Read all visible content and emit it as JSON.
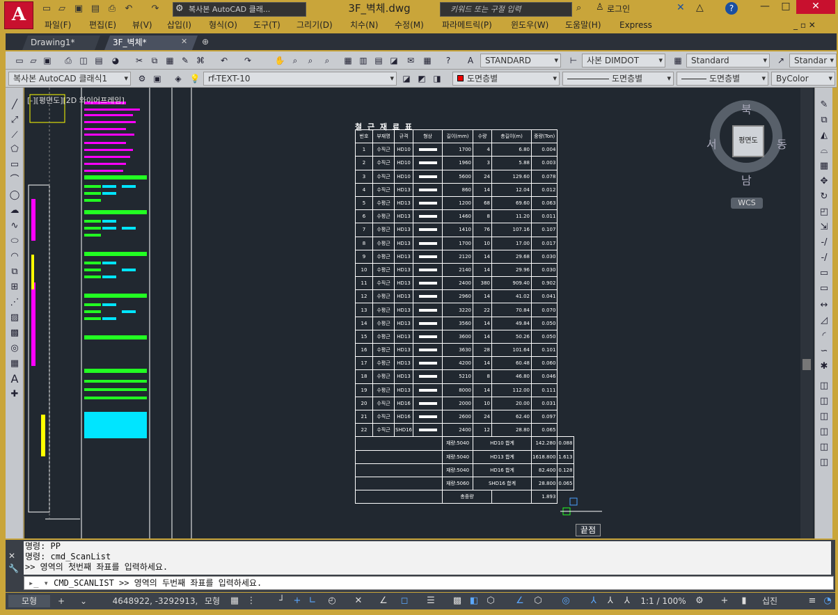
{
  "app": {
    "logo": "A",
    "workspace": "복사본 AutoCAD 클래...",
    "title": "3F_벽체.dwg",
    "search_placeholder": "키워드 또는 구절 입력",
    "login": "로그인"
  },
  "menu": [
    "파일(F)",
    "편집(E)",
    "뷰(V)",
    "삽입(I)",
    "형식(O)",
    "도구(T)",
    "그리기(D)",
    "치수(N)",
    "수정(M)",
    "파라메트릭(P)",
    "윈도우(W)",
    "도움말(H)",
    "Express"
  ],
  "tabs": [
    "Drawing1*",
    "3F_벽체*"
  ],
  "toolbar1": {
    "textstyle": "STANDARD",
    "dimstyle": "사본 DIMDOT",
    "tablestyle": "Standard",
    "mlstyle": "Standar"
  },
  "toolbar2": {
    "workspace": "복사본 AutoCAD 클래식1",
    "layer": "rf-TEXT-10",
    "color": "도면층별",
    "linetype": "도면층별",
    "lineweight": "도면층별",
    "plotstyle": "ByColor"
  },
  "viewport_label": "[-][평면도][2D 와이어프레임]",
  "viewcube": {
    "north": "북",
    "south": "남",
    "east": "동",
    "west": "서",
    "face": "평면도",
    "wcs": "WCS"
  },
  "rebar": {
    "title": "철 근 재 료 표",
    "headers": [
      "번호",
      "부재명",
      "규격",
      "형상",
      "길이(mm)",
      "수량",
      "총길이(m)",
      "중량(Ton)"
    ],
    "rows": [
      [
        "1",
        "수직근",
        "HD10",
        "",
        "1700",
        "4",
        "6.80",
        "0.004"
      ],
      [
        "2",
        "수직근",
        "HD10",
        "",
        "1960",
        "3",
        "5.88",
        "0.003"
      ],
      [
        "3",
        "수직근",
        "HD10",
        "",
        "5600",
        "24",
        "129.60",
        "0.078"
      ],
      [
        "4",
        "수직근",
        "HD13",
        "",
        "860",
        "14",
        "12.04",
        "0.012"
      ],
      [
        "5",
        "수평근",
        "HD13",
        "",
        "1200",
        "68",
        "69.60",
        "0.063"
      ],
      [
        "6",
        "수평근",
        "HD13",
        "",
        "1460",
        "8",
        "11.20",
        "0.011"
      ],
      [
        "7",
        "수평근",
        "HD13",
        "",
        "1410",
        "76",
        "107.16",
        "0.107"
      ],
      [
        "8",
        "수평근",
        "HD13",
        "",
        "1700",
        "10",
        "17.00",
        "0.017"
      ],
      [
        "9",
        "수평근",
        "HD13",
        "",
        "2120",
        "14",
        "29.68",
        "0.030"
      ],
      [
        "10",
        "수평근",
        "HD13",
        "",
        "2140",
        "14",
        "29.96",
        "0.030"
      ],
      [
        "11",
        "수직근",
        "HD13",
        "",
        "2400",
        "380",
        "909.40",
        "0.902"
      ],
      [
        "12",
        "수평근",
        "HD13",
        "",
        "2960",
        "14",
        "41.02",
        "0.041"
      ],
      [
        "13",
        "수평근",
        "HD13",
        "",
        "3220",
        "22",
        "70.84",
        "0.070"
      ],
      [
        "14",
        "수평근",
        "HD13",
        "",
        "3560",
        "14",
        "49.84",
        "0.050"
      ],
      [
        "15",
        "수평근",
        "HD13",
        "",
        "3600",
        "14",
        "50.26",
        "0.050"
      ],
      [
        "16",
        "수평근",
        "HD13",
        "",
        "3630",
        "28",
        "101.64",
        "0.101"
      ],
      [
        "17",
        "수평근",
        "HD13",
        "",
        "4200",
        "14",
        "60.48",
        "0.060"
      ],
      [
        "18",
        "수평근",
        "HD13",
        "",
        "5210",
        "8",
        "46.80",
        "0.046"
      ],
      [
        "19",
        "수평근",
        "HD13",
        "",
        "8000",
        "14",
        "112.00",
        "0.111"
      ],
      [
        "20",
        "수직근",
        "HD16",
        "",
        "2000",
        "10",
        "20.00",
        "0.031"
      ],
      [
        "21",
        "수직근",
        "HD16",
        "",
        "2600",
        "24",
        "62.40",
        "0.097"
      ],
      [
        "22",
        "수직근",
        "SHD16",
        "",
        "2400",
        "12",
        "28.80",
        "0.065"
      ]
    ],
    "summary": [
      [
        "재량:5040",
        "HD10 합계",
        "142.280",
        "0.088"
      ],
      [
        "재량:5040",
        "HD13 합계",
        "1618.800",
        "1.613"
      ],
      [
        "재량:5040",
        "HD16 합계",
        "82.400",
        "0.128"
      ],
      [
        "재량:5060",
        "SHD16 합계",
        "28.800",
        "0.065"
      ]
    ],
    "total_label": "총중량",
    "total": "1.893"
  },
  "tooltip": "끝점",
  "command": {
    "history": [
      "명령: PP",
      "명령: cmd_ScanList",
      ">> 영역의 첫번째 좌표를 입력하세요."
    ],
    "prompt": "CMD_SCANLIST >> 영역의 두번째 좌표를 입력하세요."
  },
  "status": {
    "model": "모형",
    "coords": "4648922, -3292913, 0",
    "model2": "모형",
    "scale": "1:1 / 100%",
    "ucs": "십진"
  }
}
